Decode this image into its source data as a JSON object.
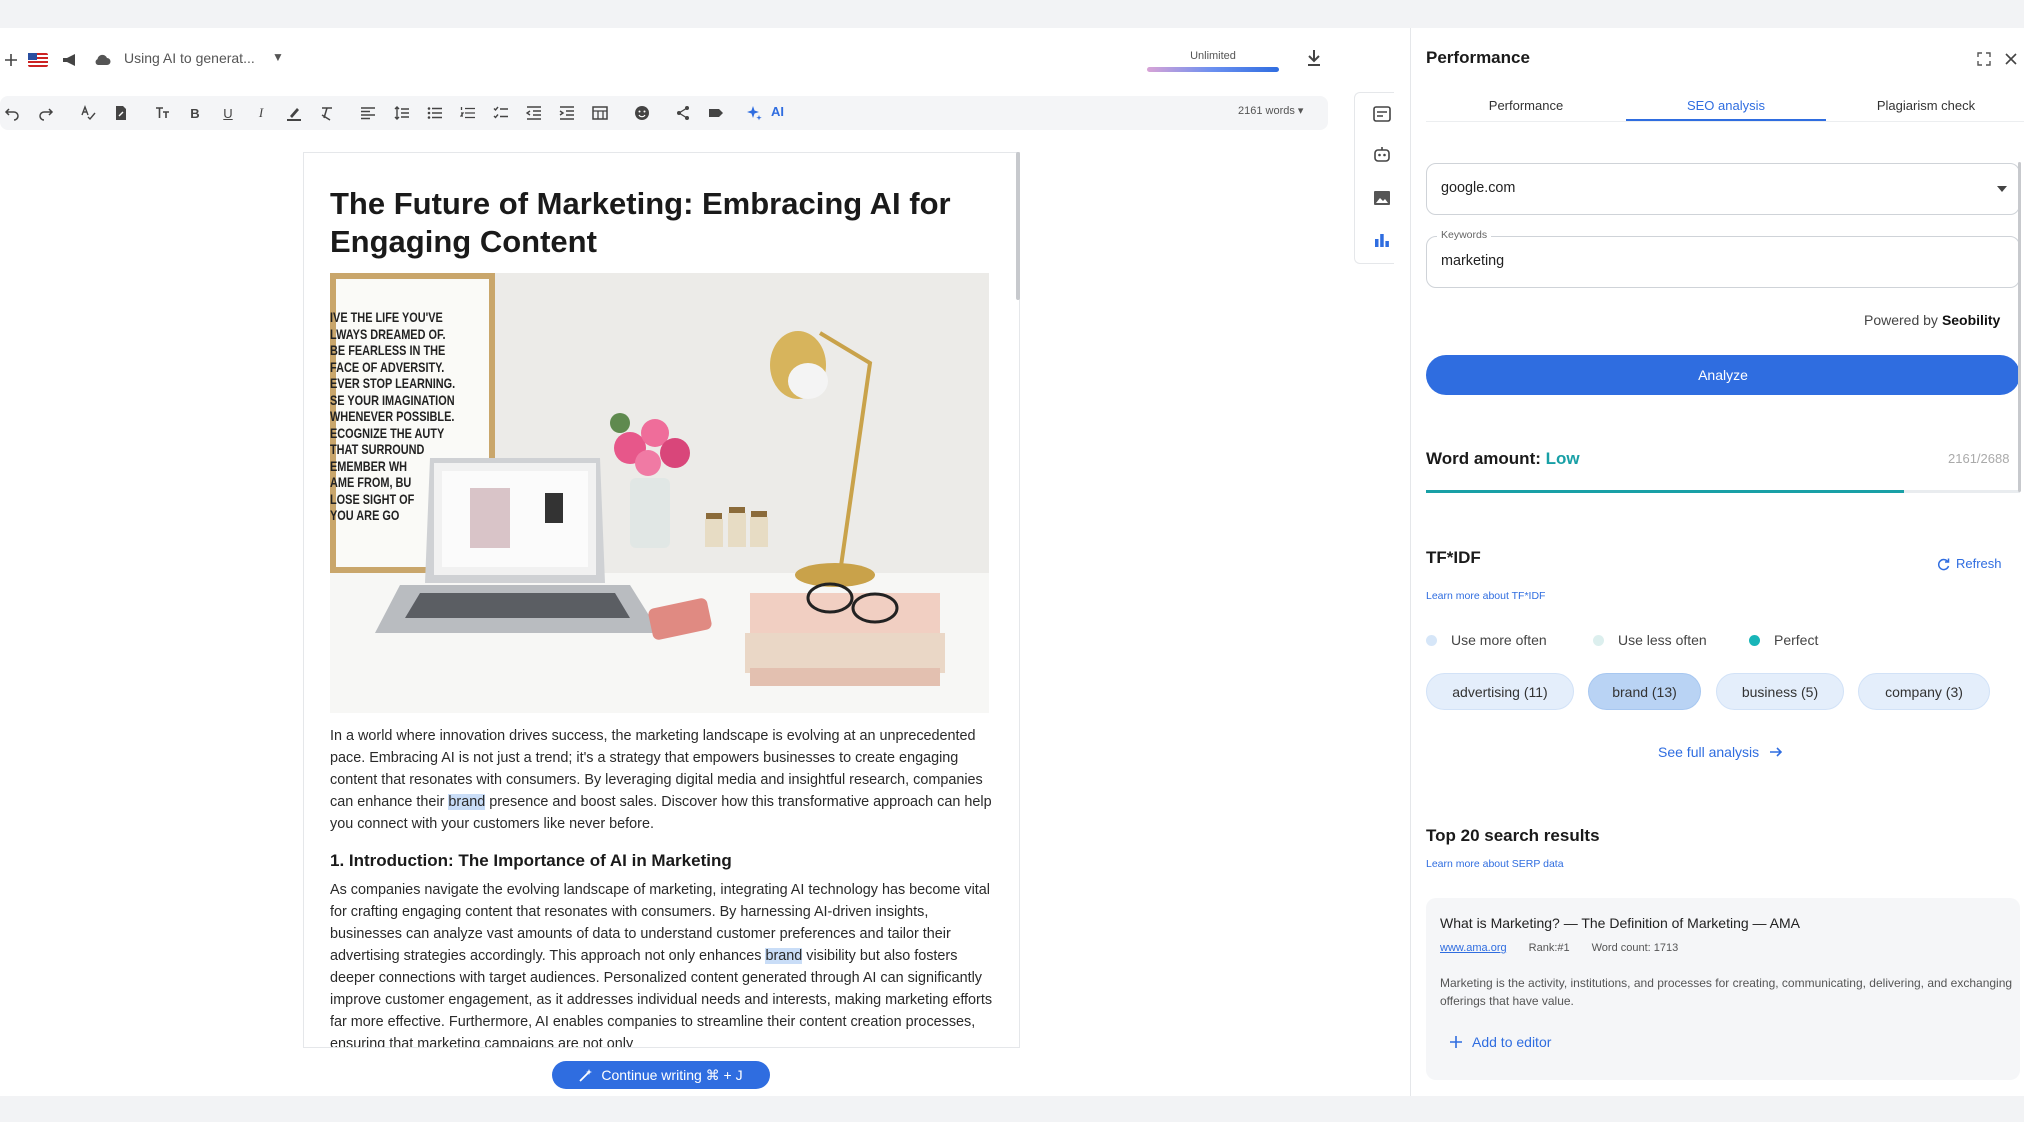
{
  "header": {
    "status_text": "Using AI to generat...",
    "quota_label": "Unlimited"
  },
  "toolbar": {
    "ai_label": "AI",
    "word_count": "2161 words ▾"
  },
  "document": {
    "title": "The Future of Marketing: Embracing AI for Engaging Content",
    "intro_before": "In a world where innovation drives success, the marketing landscape is evolving at an unprecedented pace. Embracing AI is not just a trend; it's a strategy that empowers businesses to create engaging content that resonates with consumers. By leveraging digital media and insightful research, companies can enhance their ",
    "highlight_word": "brand",
    "intro_after": " presence and boost sales. Discover how this transformative approach can help you connect with your customers like never before.",
    "section1_heading": "1. Introduction: The Importance of AI in Marketing",
    "section1_before": "As companies navigate the evolving landscape of marketing, integrating AI technology has become vital for crafting engaging content that resonates with consumers. By harnessing AI-driven insights, businesses can analyze vast amounts of data to understand customer preferences and tailor their advertising strategies accordingly. This approach not only enhances ",
    "section1_after": " visibility but also fosters deeper connections with target audiences. Personalized content generated through AI can significantly improve customer engagement, as it addresses individual needs and interests, making marketing efforts far more effective. Furthermore, AI enables companies to streamline their content creation processes, ensuring that marketing campaigns are not only",
    "image_poster_text": "IVE THE LIFE YOU'VE\nLWAYS DREAMED OF.\nBE FEARLESS IN THE\nFACE OF ADVERSITY.\nEVER STOP LEARNING.\nSE YOUR IMAGINATION\nWHENEVER POSSIBLE.\nECOGNIZE THE AUTY\nTHAT SURROUND\nEMEMBER WH\nAME FROM, BU\nLOSE SIGHT OF\nYOU ARE GO"
  },
  "continue_button": "Continue writing ⌘ + J",
  "panel": {
    "title": "Performance",
    "tabs": [
      {
        "label": "Performance"
      },
      {
        "label": "SEO analysis"
      },
      {
        "label": "Plagiarism check"
      }
    ],
    "search_engine": "google.com",
    "keywords_label": "Keywords",
    "keywords_value": "marketing",
    "powered_by": "Powered by",
    "powered_brand": "Seobility",
    "analyze": "Analyze",
    "word_amount_label": "Word amount:",
    "word_amount_status": "Low",
    "word_ratio": "2161/2688",
    "word_progress": 0.804,
    "tfidf_title": "TF*IDF",
    "refresh": "Refresh",
    "learn_tfidf": "Learn more about TF*IDF",
    "legend": [
      {
        "label": "Use more often",
        "color": "#d6e6f8"
      },
      {
        "label": "Use less often",
        "color": "#dcefee"
      },
      {
        "label": "Perfect",
        "color": "#18b5b8"
      }
    ],
    "chips": [
      {
        "label": "advertising (11)"
      },
      {
        "label": "brand (13)"
      },
      {
        "label": "business (5)"
      },
      {
        "label": "company (3)"
      }
    ],
    "see_full": "See full analysis",
    "serp_title": "Top 20 search results",
    "learn_serp": "Learn more about SERP data",
    "result": {
      "title": "What is Marketing? — The Definition of Marketing — AMA",
      "url": "www.ama.org",
      "rank": "Rank:#1",
      "word_count": "Word count: 1713",
      "description": "Marketing is the activity, institutions, and processes for creating, communicating, delivering, and exchanging offerings that have value.",
      "add": "Add to editor"
    }
  },
  "colors": {
    "accent": "#2f6de0",
    "teal": "#18a0a6"
  }
}
